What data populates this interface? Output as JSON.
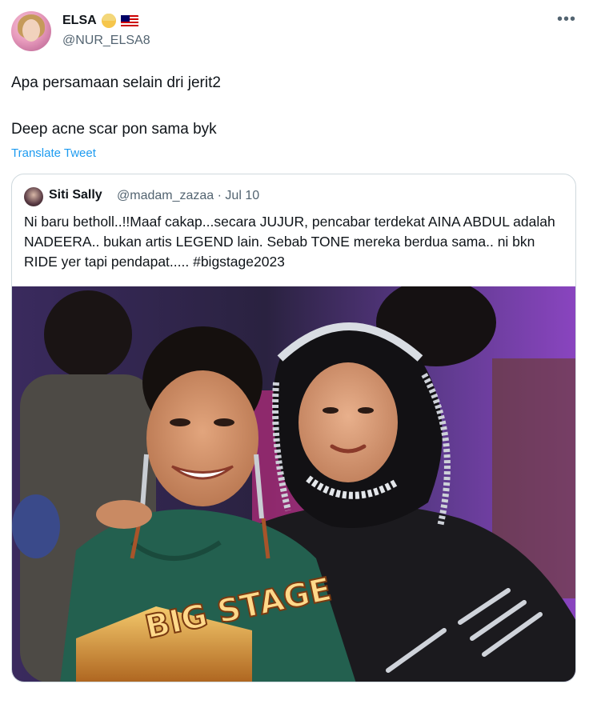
{
  "tweet": {
    "display_name": "ELSA",
    "handle": "@NUR_ELSA8",
    "more_icon": "more-horizontal-icon",
    "text_line1": "Apa persamaan selain dri jerit2",
    "text_line2": "Deep acne scar pon sama byk",
    "translate_label": "Translate Tweet",
    "accent_color": "#1d9bf0"
  },
  "quote": {
    "display_name": "Siti Sally",
    "handle": "@madam_zazaa",
    "separator": "·",
    "date": "Jul 10",
    "text": "Ni baru betholl..!!Maaf cakap...secara JUJUR, pencabar terdekat AINA ABDUL adalah NADEERA.. bukan artis LEGEND lain. Sebab TONE mereka berdua sama.. ni bkn RIDE yer tapi pendapat..... #bigstage2023",
    "media_logo_text": "BIG STAGE"
  }
}
